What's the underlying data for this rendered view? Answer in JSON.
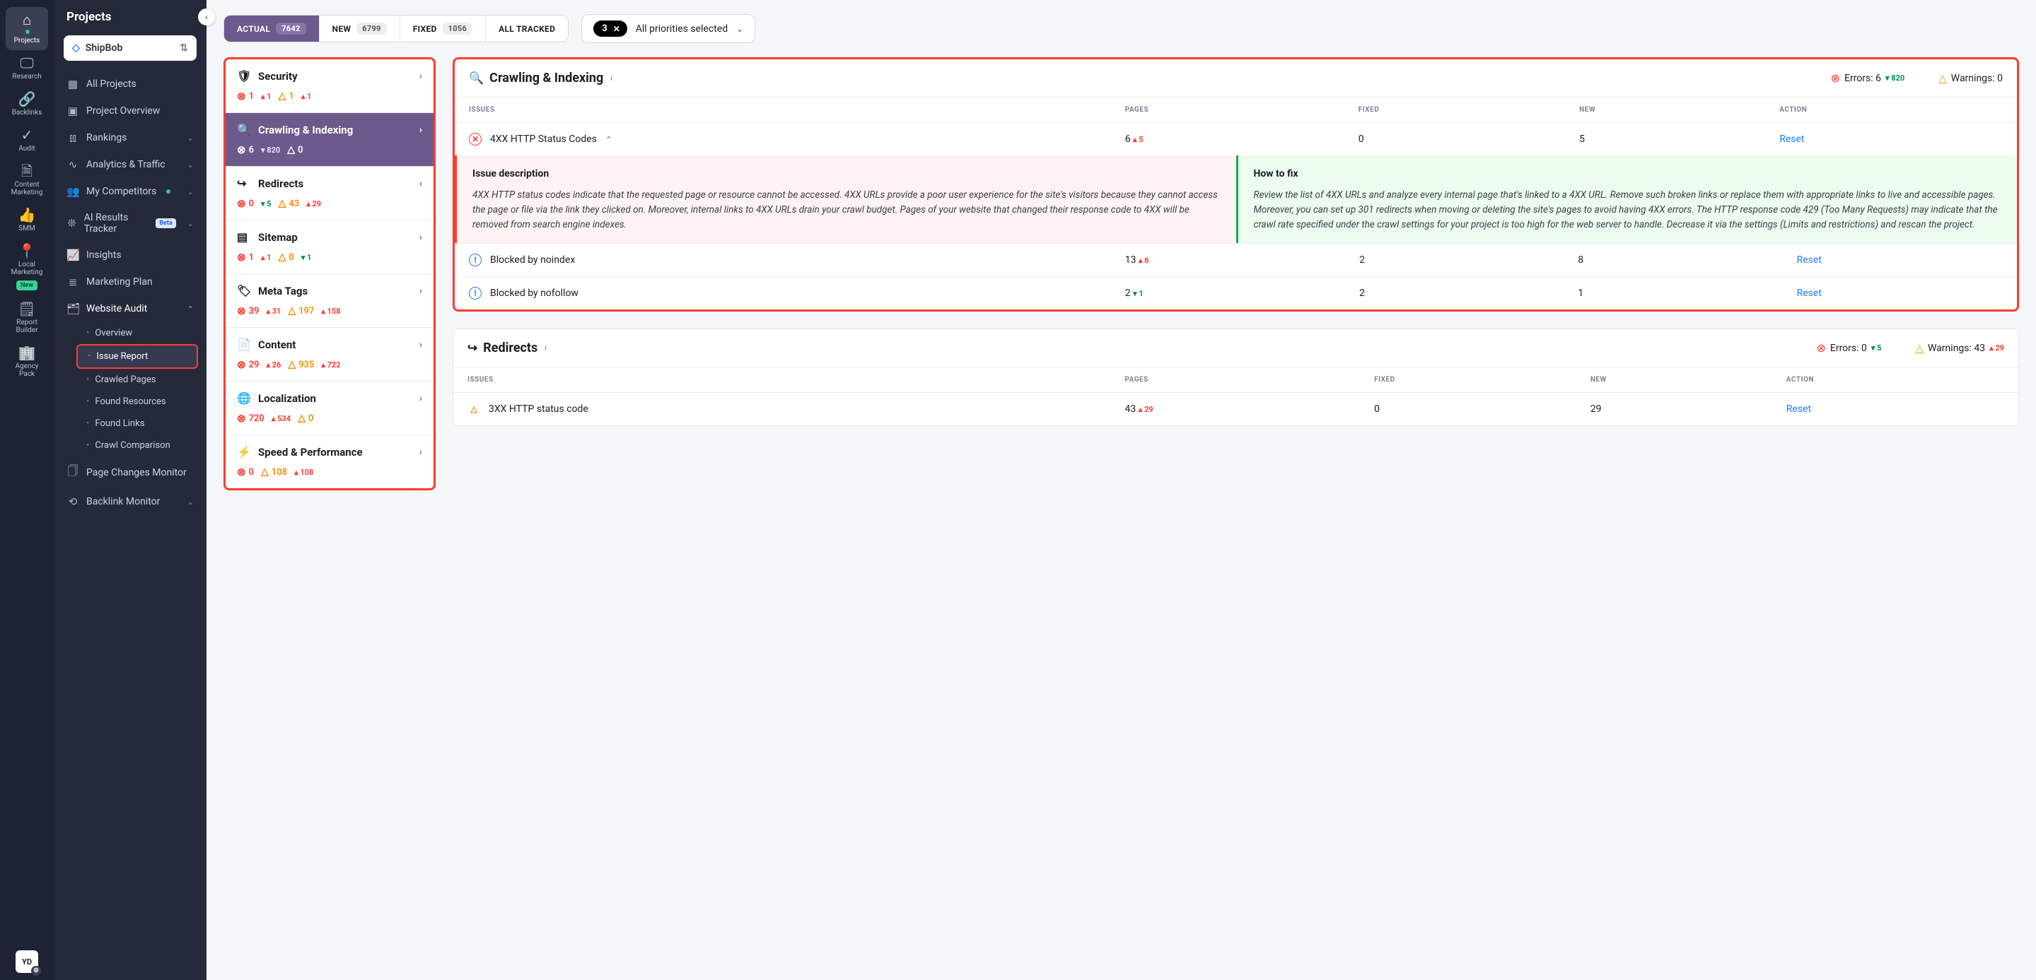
{
  "rail": [
    {
      "icon": "ic-home",
      "label": "Projects",
      "active": true,
      "dot": true
    },
    {
      "icon": "ic-monitor",
      "label": "Research"
    },
    {
      "icon": "ic-link",
      "label": "Backlinks"
    },
    {
      "icon": "ic-check",
      "label": "Audit"
    },
    {
      "icon": "ic-doc",
      "label": "Content Marketing"
    },
    {
      "icon": "ic-thumb",
      "label": "SMM"
    },
    {
      "icon": "ic-pin",
      "label": "Local Marketing",
      "badge": "New"
    },
    {
      "icon": "ic-report",
      "label": "Report Builder"
    },
    {
      "icon": "ic-buildings",
      "label": "Agency Pack"
    }
  ],
  "avatar": "YD",
  "sidepanel": {
    "title": "Projects",
    "project": "ShipBob",
    "items": [
      {
        "icon": "ic-grid",
        "label": "All Projects"
      },
      {
        "icon": "ic-overview",
        "label": "Project Overview"
      },
      {
        "icon": "ic-bars",
        "label": "Rankings",
        "chev": true
      },
      {
        "icon": "ic-pulse",
        "label": "Analytics & Traffic",
        "chev": true
      },
      {
        "icon": "ic-people",
        "label": "My Competitors",
        "dot": true,
        "chev": true
      },
      {
        "icon": "ic-spark",
        "label": "AI Results Tracker",
        "beta": "Beta",
        "chev": true
      },
      {
        "icon": "ic-trend",
        "label": "Insights"
      },
      {
        "icon": "ic-plan",
        "label": "Marketing Plan"
      },
      {
        "icon": "ic-audit",
        "label": "Website Audit",
        "chev": true,
        "expanded": true,
        "sub": [
          {
            "label": "Overview"
          },
          {
            "label": "Issue Report",
            "highlight": true
          },
          {
            "label": "Crawled Pages"
          },
          {
            "label": "Found Resources"
          },
          {
            "label": "Found Links"
          },
          {
            "label": "Crawl Comparison"
          }
        ]
      },
      {
        "icon": "ic-page",
        "label": "Page Changes Monitor"
      },
      {
        "icon": "ic-backlink",
        "label": "Backlink Monitor",
        "chev": true
      }
    ]
  },
  "tabs": [
    {
      "label": "ACTUAL",
      "count": "7642",
      "active": true
    },
    {
      "label": "NEW",
      "count": "6799"
    },
    {
      "label": "FIXED",
      "count": "1056"
    },
    {
      "label": "ALL TRACKED"
    }
  ],
  "priority": {
    "count": "3",
    "label": "All priorities selected"
  },
  "categories": [
    {
      "icon": "ic-shield",
      "label": "Security",
      "err": "1",
      "err_d": "1",
      "err_dir": "up",
      "warn": "1",
      "warn_d": "1",
      "warn_dir": "up"
    },
    {
      "icon": "ic-search",
      "label": "Crawling & Indexing",
      "selected": true,
      "err": "6",
      "err_d": "820",
      "err_dir": "down",
      "warn": "0"
    },
    {
      "icon": "ic-redirect",
      "label": "Redirects",
      "err": "0",
      "err_d": "5",
      "err_dir": "down",
      "warn": "43",
      "warn_d": "29",
      "warn_dir": "up"
    },
    {
      "icon": "ic-sitemap",
      "label": "Sitemap",
      "err": "1",
      "err_d": "1",
      "err_dir": "up",
      "warn": "0",
      "warn_d": "1",
      "warn_dir": "down"
    },
    {
      "icon": "ic-tag",
      "label": "Meta Tags",
      "err": "39",
      "err_d": "31",
      "err_dir": "up",
      "warn": "197",
      "warn_d": "158",
      "warn_dir": "up"
    },
    {
      "icon": "ic-content",
      "label": "Content",
      "err": "29",
      "err_d": "26",
      "err_dir": "up",
      "warn": "935",
      "warn_d": "722",
      "warn_dir": "up"
    },
    {
      "icon": "ic-globe",
      "label": "Localization",
      "err": "720",
      "err_d": "534",
      "err_dir": "up",
      "warn": "0"
    },
    {
      "icon": "ic-speed",
      "label": "Speed & Performance",
      "err": "0",
      "warn": "108",
      "warn_d": "108",
      "warn_dir": "up"
    }
  ],
  "table_headers": {
    "issues": "ISSUES",
    "pages": "PAGES",
    "fixed": "FIXED",
    "new": "NEW",
    "action": "ACTION"
  },
  "section1": {
    "icon": "ic-search",
    "title": "Crawling & Indexing",
    "err_label": "Errors: 6",
    "err_d": "820",
    "err_dir": "down",
    "warn_label": "Warnings: 0",
    "rows": [
      {
        "type": "err",
        "name": "4XX HTTP Status Codes",
        "expanded": true,
        "pages": "6",
        "pages_d": "5",
        "pages_dir": "up",
        "fixed": "0",
        "new": "5",
        "action": "Reset"
      }
    ],
    "expand": {
      "desc_h": "Issue description",
      "desc": "4XX HTTP status codes indicate that the requested page or resource cannot be accessed. 4XX URLs provide a poor user experience for the site's visitors because they cannot access the page or file via the link they clicked on. Moreover, internal links to 4XX URLs drain your crawl budget. Pages of your website that changed their response code to 4XX will be removed from search engine indexes.",
      "fix_h": "How to fix",
      "fix": "Review the list of 4XX URLs and analyze every internal page that's linked to a 4XX URL. Remove such broken links or replace them with appropriate links to live and accessible pages. Moreover, you can set up 301 redirects when moving or deleting the site's pages to avoid having 4XX errors. The HTTP response code 429 (Too Many Requests) may indicate that the crawl rate specified under the crawl settings for your project is too high for the web server to handle. Decrease it via the settings (Limits and restrictions) and rescan the project."
    },
    "rows2": [
      {
        "type": "info",
        "name": "Blocked by noindex",
        "pages": "13",
        "pages_d": "6",
        "pages_dir": "up",
        "fixed": "2",
        "new": "8",
        "action": "Reset"
      },
      {
        "type": "info",
        "name": "Blocked by nofollow",
        "pages": "2",
        "pages_d": "1",
        "pages_dir": "down",
        "fixed": "2",
        "new": "1",
        "action": "Reset"
      }
    ]
  },
  "section2": {
    "icon": "ic-redirect",
    "title": "Redirects",
    "err_label": "Errors: 0",
    "err_d": "5",
    "err_dir": "down",
    "warn_label": "Warnings: 43",
    "warn_d": "29",
    "warn_dir": "up",
    "rows": [
      {
        "type": "warn",
        "name": "3XX HTTP status code",
        "pages": "43",
        "pages_d": "29",
        "pages_dir": "up",
        "fixed": "0",
        "new": "29",
        "action": "Reset"
      }
    ]
  }
}
